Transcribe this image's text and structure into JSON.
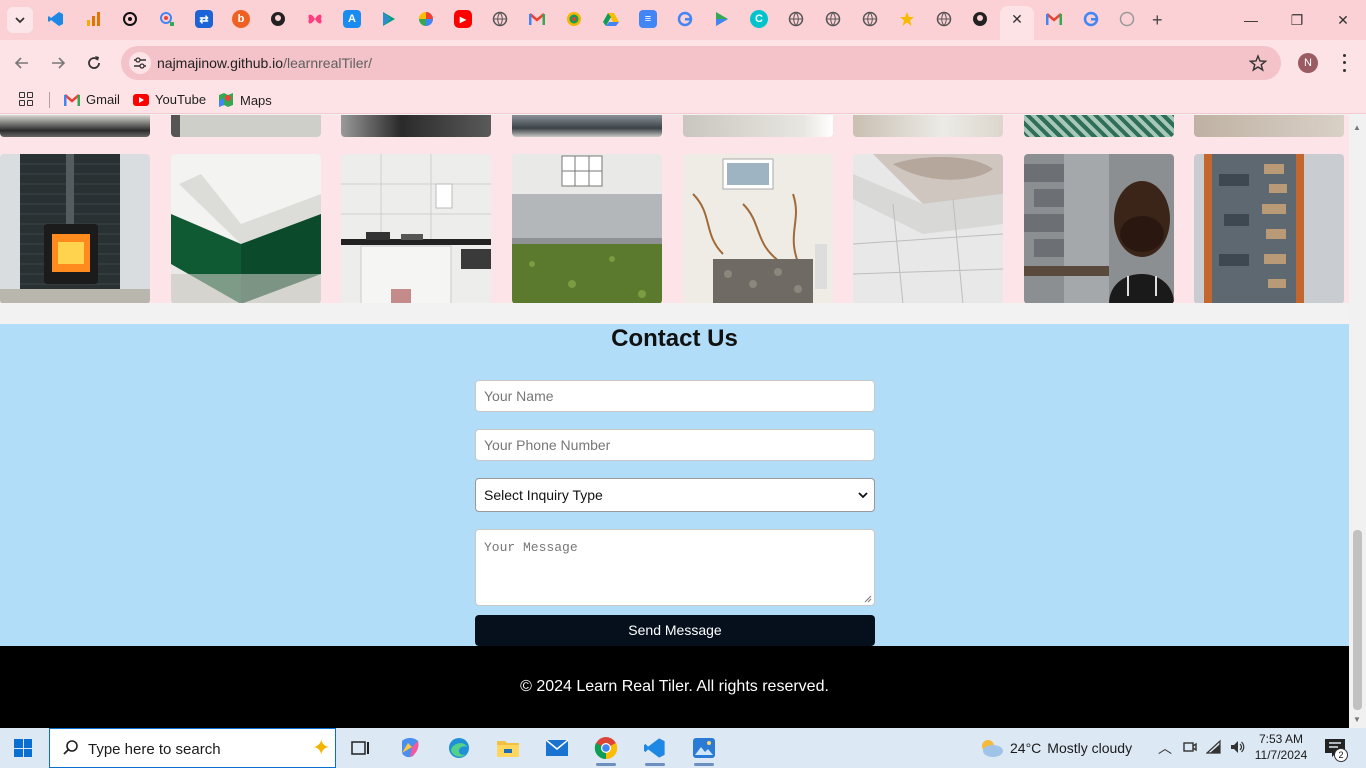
{
  "browser": {
    "tab_favicons": [
      "vscode-icon",
      "analytics-icon",
      "openai-icon",
      "lens-icon",
      "jira-icon",
      "bitly-icon",
      "github-icon",
      "butterfly-icon",
      "appstore-icon",
      "play-icon",
      "photos-icon",
      "youtube-icon",
      "globe-icon",
      "gmail-icon",
      "earth-icon",
      "drive-icon",
      "docs-icon",
      "google-icon",
      "play-store-icon",
      "canva-icon",
      "globe-icon",
      "globe-icon",
      "globe-icon",
      "star-icon",
      "globe-icon",
      "github-icon",
      "close-icon",
      "gmail-icon",
      "google-icon",
      "globe-icon"
    ],
    "address": {
      "host": "najmajinow.github.io",
      "path": "/learnrealTiler/"
    },
    "profile_initial": "N",
    "bookmarks": [
      {
        "label": "Gmail",
        "icon": "gmail-icon"
      },
      {
        "label": "YouTube",
        "icon": "youtube-icon"
      },
      {
        "label": "Maps",
        "icon": "maps-icon"
      }
    ]
  },
  "page": {
    "contact": {
      "title": "Contact Us",
      "name_placeholder": "Your Name",
      "phone_placeholder": "Your Phone Number",
      "inquiry_selected": "Select Inquiry Type",
      "message_placeholder": "Your Message",
      "send_label": "Send Message"
    },
    "footer": {
      "text": "© 2024 Learn Real Tiler. All rights reserved."
    }
  },
  "taskbar": {
    "search_placeholder": "Type here to search",
    "weather": {
      "temp": "24°C",
      "condition": "Mostly cloudy"
    },
    "clock": {
      "time": "7:53 AM",
      "date": "11/7/2024"
    },
    "notification_count": "2"
  }
}
